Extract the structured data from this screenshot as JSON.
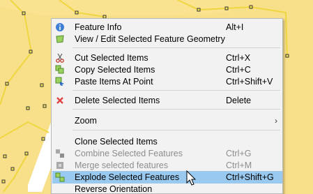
{
  "map": {
    "fill_color": "#f8e08a",
    "edge_color": "#e8d34a",
    "vertex_color": "#f5e35b"
  },
  "menu": {
    "highlight_color": "#99c9ef",
    "items": [
      {
        "label": "Feature Info",
        "shortcut": "Alt+I",
        "icon": "info-icon",
        "enabled": true
      },
      {
        "label": "View / Edit Selected Feature Geometry",
        "shortcut": "",
        "icon": "edit-geometry-icon",
        "enabled": true
      },
      {
        "label": "Cut Selected Items",
        "shortcut": "Ctrl+X",
        "icon": "scissors-icon",
        "enabled": true
      },
      {
        "label": "Copy Selected Items",
        "shortcut": "Ctrl+C",
        "icon": "copy-icon",
        "enabled": true
      },
      {
        "label": "Paste Items At Point",
        "shortcut": "Ctrl+Shift+V",
        "icon": "paste-icon",
        "enabled": true
      },
      {
        "label": "Delete Selected Items",
        "shortcut": "Delete",
        "icon": "delete-x-icon",
        "enabled": true
      },
      {
        "label": "Zoom",
        "shortcut": "",
        "icon": "",
        "enabled": true,
        "submenu": true
      },
      {
        "label": "Clone Selected Items",
        "shortcut": "",
        "icon": "",
        "enabled": true
      },
      {
        "label": "Combine Selected Features",
        "shortcut": "Ctrl+G",
        "icon": "combine-icon",
        "enabled": false
      },
      {
        "label": "Merge selected features",
        "shortcut": "Ctrl+M",
        "icon": "merge-icon",
        "enabled": false
      },
      {
        "label": "Explode Selected Features",
        "shortcut": "Ctrl+Shift+G",
        "icon": "explode-icon",
        "enabled": true,
        "highlighted": true
      },
      {
        "label": "Reverse Orientation",
        "shortcut": "",
        "icon": "",
        "enabled": true
      }
    ]
  }
}
